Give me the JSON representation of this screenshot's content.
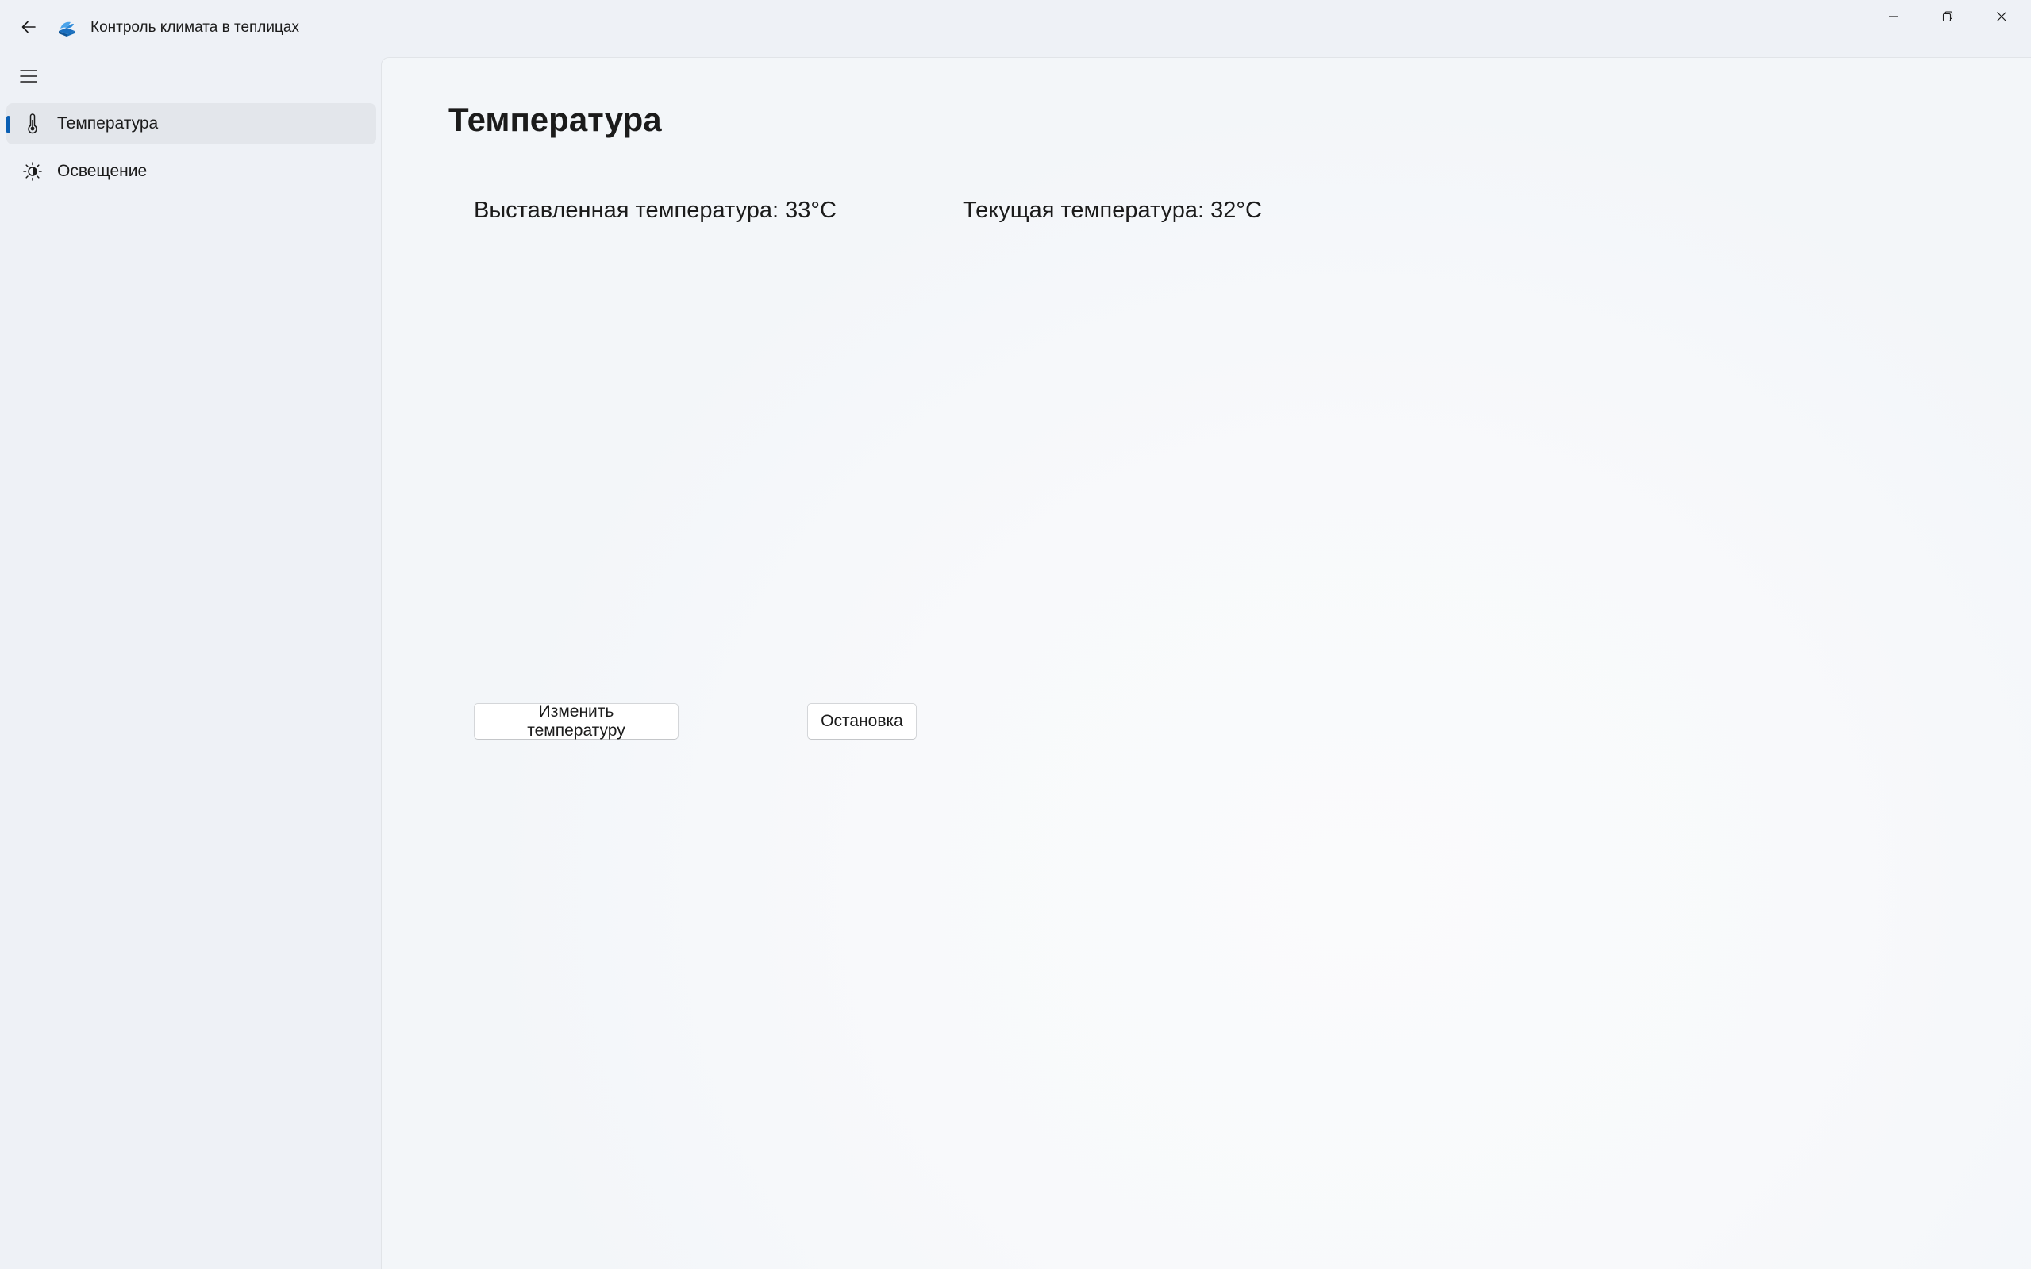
{
  "window": {
    "title": "Контроль климата в теплицах"
  },
  "sidebar": {
    "items": [
      {
        "label": "Температура",
        "icon": "thermometer-icon",
        "selected": true
      },
      {
        "label": "Освещение",
        "icon": "brightness-icon",
        "selected": false
      }
    ]
  },
  "main": {
    "page_title": "Температура",
    "set_temperature_text": "Выставленная температура: 33°C",
    "current_temperature_text": "Текущая температура: 32°C",
    "change_button_label": "Изменить температуру",
    "stop_button_label": "Остановка"
  },
  "colors": {
    "accent": "#0a5fb4",
    "app_icon": "#2b88d8",
    "background": "#eef1f6",
    "content_background": "#f8f9fb"
  }
}
